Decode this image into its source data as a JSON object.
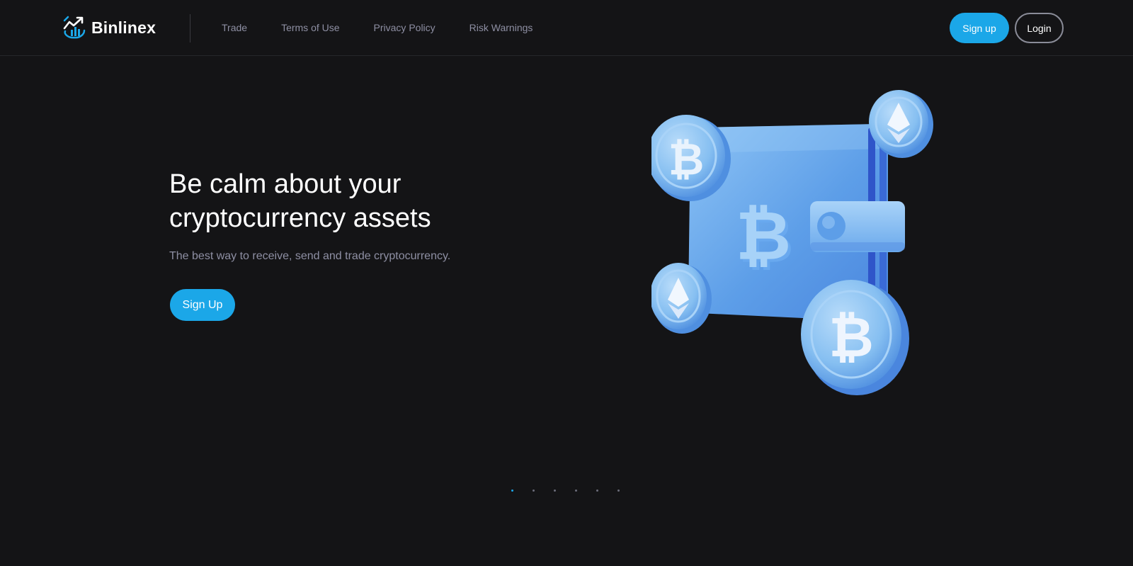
{
  "brand": {
    "name": "Binlinex",
    "logo_icon": "rising-chart-logo-icon",
    "accent_color": "#1ba7e8"
  },
  "nav": {
    "items": [
      {
        "label": "Trade"
      },
      {
        "label": "Terms of Use"
      },
      {
        "label": "Privacy Policy"
      },
      {
        "label": "Risk Warnings"
      }
    ]
  },
  "header_actions": {
    "signup_label": "Sign up",
    "login_label": "Login"
  },
  "hero": {
    "title": "Be calm about your cryptocurrency assets",
    "subtitle": "The best way to receive, send and trade cryptocurrency.",
    "cta_label": "Sign Up",
    "illustration": "crypto-wallet-with-bitcoin-and-ethereum-coins"
  },
  "carousel": {
    "slide_count": 6,
    "active_index": 0
  },
  "colors": {
    "background": "#141416",
    "muted_text": "#8e8fa3",
    "coin_blue": "#7fbdf0"
  }
}
